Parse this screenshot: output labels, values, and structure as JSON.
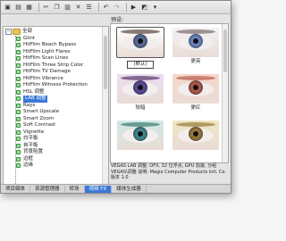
{
  "toolbar": {
    "buttons": [
      "folder-open-icon",
      "save-icon",
      "grid-icon",
      "cut-icon",
      "copy-icon",
      "paste-icon",
      "delete-icon",
      "properties-icon",
      "undo-icon",
      "redo-icon",
      "play-icon",
      "effects-icon",
      "menu-icon"
    ]
  },
  "presets_label": "预设:",
  "tree": {
    "root_label": "全部",
    "items": [
      "Glint",
      "HitFilm Beach Bypass",
      "HitFilm Light Flares",
      "HitFilm Scan Lines",
      "HitFilm Three Strip Color",
      "HitFilm TV Damage",
      "HitFilm Vibrance",
      "HitFilm Witness Protection",
      "HSL 调整",
      "LAB 调整",
      "Rays",
      "Smart Upscale",
      "Smart Zoom",
      "Soft Contrast",
      "Vignette",
      "白平衡",
      "自平衡",
      "背景阻置",
      "边框",
      "边缘"
    ],
    "selected_index": 9
  },
  "presets": [
    {
      "caption": "(默认)",
      "iris_color": "#5b6d9a",
      "brow_color": "#6b5a55",
      "tint": "#ffffff",
      "selected": true
    },
    {
      "caption": "更亮",
      "iris_color": "#6a85c0",
      "brow_color": "#8a7a75",
      "tint": "#f2f2f6",
      "selected": false
    },
    {
      "caption": "较暗",
      "iris_color": "#5a4a9a",
      "brow_color": "#6a4a7a",
      "tint": "#eadff0",
      "selected": false
    },
    {
      "caption": "更红",
      "iris_color": "#b05a4a",
      "brow_color": "#c06a5a",
      "tint": "#f6d6cc",
      "selected": false
    },
    {
      "caption": "",
      "iris_color": "#3f8a8a",
      "brow_color": "#4a8a7a",
      "tint": "#cfe8e6",
      "selected": false
    },
    {
      "caption": "",
      "iris_color": "#9a7a3a",
      "brow_color": "#a08a4a",
      "tint": "#f0e4c2",
      "selected": false
    }
  ],
  "description": "VEGAS LAB 调整: OFX, 32 位浮点, GPU 加速, 分组 VEGAS\\调整 说明: Magix Computer Products Intl. Co. 版本 1.0",
  "tabs": [
    {
      "label": "项目媒体",
      "active": false
    },
    {
      "label": "资源管理器",
      "active": false
    },
    {
      "label": "转场",
      "active": false
    },
    {
      "label": "视频 FX",
      "active": true
    },
    {
      "label": "媒体生成器",
      "active": false
    }
  ]
}
